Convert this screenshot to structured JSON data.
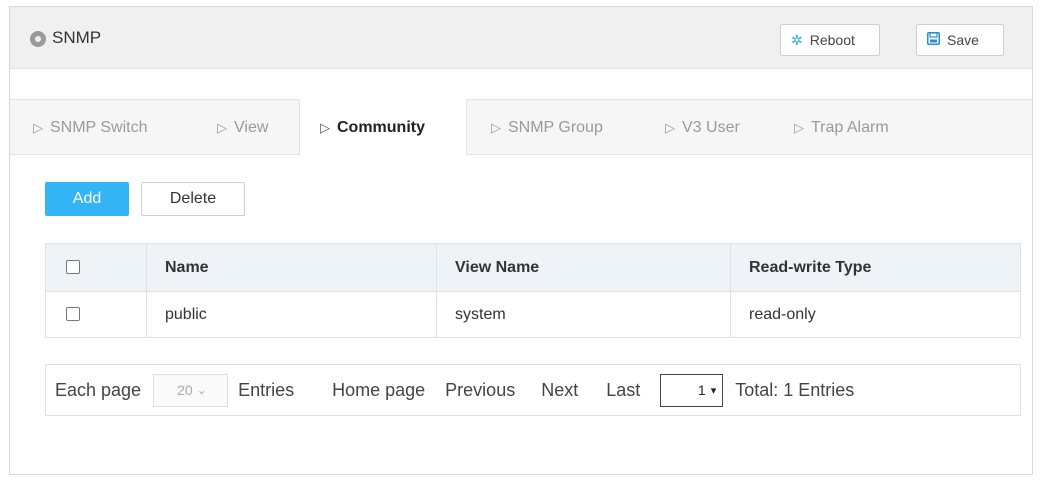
{
  "header": {
    "title": "SNMP",
    "title_icon": "location-dot-icon",
    "reboot_label": "Reboot",
    "reboot_icon": "spinner-icon",
    "save_label": "Save",
    "save_icon": "floppy-disk-icon"
  },
  "tabs": [
    {
      "label": "SNMP Switch",
      "active": false
    },
    {
      "label": "View",
      "active": false
    },
    {
      "label": "Community",
      "active": true
    },
    {
      "label": "SNMP Group",
      "active": false
    },
    {
      "label": "V3 User",
      "active": false
    },
    {
      "label": "Trap Alarm",
      "active": false
    }
  ],
  "toolbar": {
    "add_label": "Add",
    "delete_label": "Delete",
    "add_color": "#33b5f5"
  },
  "table": {
    "columns": [
      "Name",
      "View Name",
      "Read-write Type"
    ],
    "rows": [
      {
        "name": "public",
        "view_name": "system",
        "rw_type": "read-only",
        "checked": false
      }
    ]
  },
  "pagination": {
    "each_page_label": "Each page",
    "page_size": "20",
    "entries_label": "Entries",
    "home_label": "Home page",
    "previous_label": "Previous",
    "next_label": "Next",
    "last_label": "Last",
    "current_page": "1",
    "total_label": "Total: 1 Entries"
  }
}
